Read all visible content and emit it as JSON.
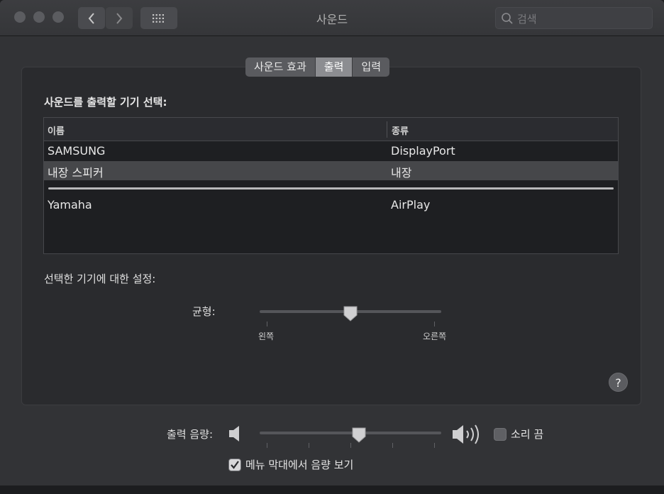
{
  "window": {
    "title": "사운드"
  },
  "search": {
    "placeholder": "검색"
  },
  "tabs": [
    {
      "label": "사운드 효과",
      "active": false
    },
    {
      "label": "출력",
      "active": true
    },
    {
      "label": "입력",
      "active": false
    }
  ],
  "output": {
    "heading": "사운드를 출력할 기기 선택:",
    "columns": {
      "name": "이름",
      "type": "종류"
    },
    "devices": [
      {
        "name": "SAMSUNG",
        "type": "DisplayPort",
        "selected": false
      },
      {
        "name": "내장 스피커",
        "type": "내장",
        "selected": true
      },
      {
        "name": "Yamaha",
        "type": "AirPlay",
        "selected": false
      }
    ],
    "settings_label": "선택한 기기에 대한 설정:",
    "balance": {
      "label": "균형:",
      "left_label": "왼쪽",
      "right_label": "오른쪽",
      "value": 0.5
    }
  },
  "help": {
    "label": "?"
  },
  "volume": {
    "label": "출력 음량:",
    "value": 0.55,
    "mute_label": "소리 끔",
    "mute_checked": false,
    "show_in_menu_label": "메뉴 막대에서 음량 보기",
    "show_in_menu_checked": true
  },
  "icons": {
    "back": "chevron-left-icon",
    "forward": "chevron-right-icon",
    "grid": "grid-icon",
    "search": "search-icon",
    "volume_low": "speaker-low-icon",
    "volume_high": "speaker-high-icon"
  }
}
